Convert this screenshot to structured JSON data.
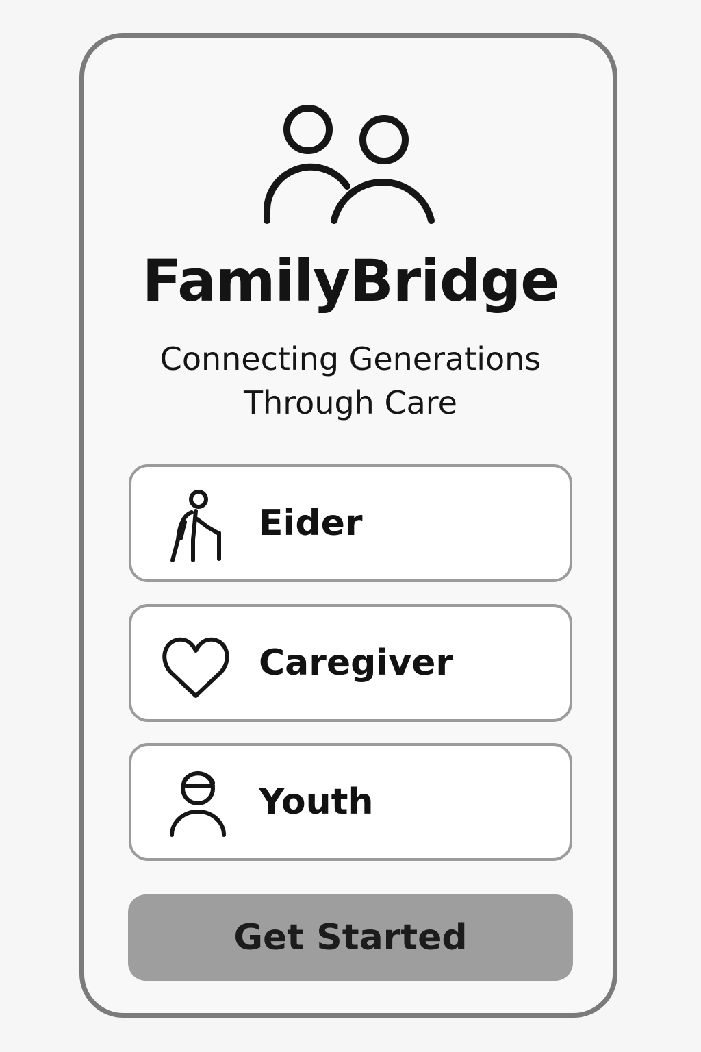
{
  "app": {
    "title": "FamilyBridge",
    "tagline_line1": "Connecting Generations",
    "tagline_line2": "Through Care"
  },
  "logo": {
    "icon": "two-people-icon"
  },
  "roles": [
    {
      "id": "elder",
      "label": "Eider",
      "icon": "elder-with-cane-icon"
    },
    {
      "id": "caregiver",
      "label": "Caregiver",
      "icon": "heart-icon"
    },
    {
      "id": "youth",
      "label": "Youth",
      "icon": "youth-person-icon"
    }
  ],
  "cta": {
    "label": "Get Started"
  },
  "colors": {
    "background": "#f6f6f6",
    "frame_border": "#7b7b7b",
    "option_border": "#9b9b9b",
    "button_fill": "#9e9e9e",
    "text": "#111111"
  }
}
